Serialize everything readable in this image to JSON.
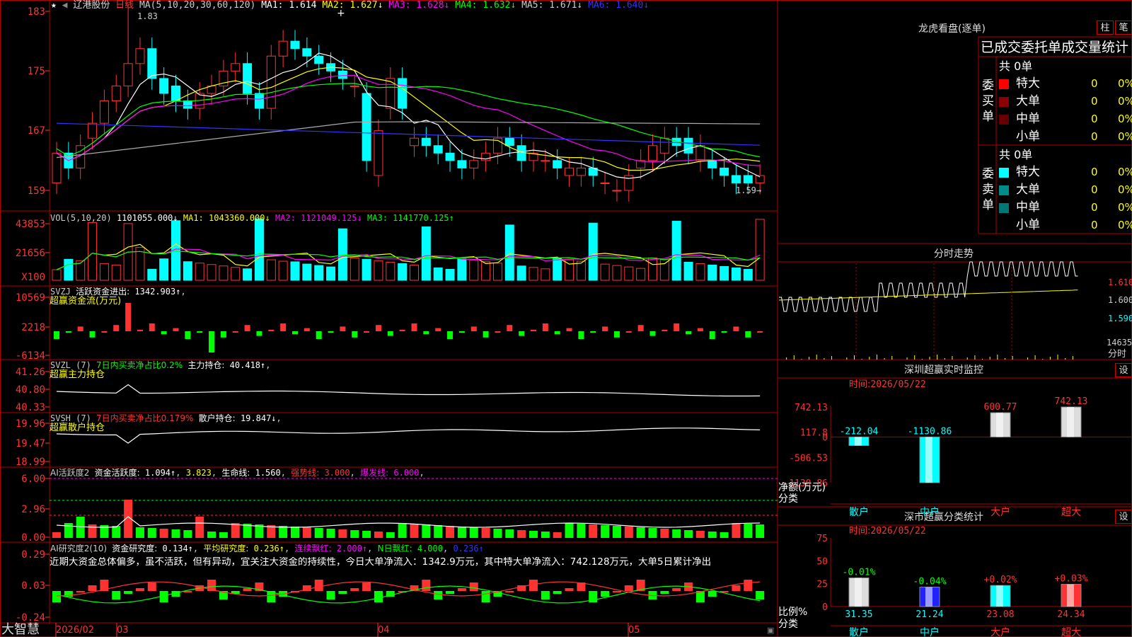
{
  "header": {
    "star": "★",
    "prev_arrow": "◀",
    "name": "辽港股份",
    "period": "日线",
    "ma_label": "MA(5,10,20,30,60,120)",
    "ma1_label": "MA1:",
    "ma1_value": "1.614",
    "ma2_label": "MA2:",
    "ma2_value": "1.627↓",
    "ma3_label": "MA3:",
    "ma3_value": "1.628↓",
    "ma4_label": "MA4:",
    "ma4_value": "1.632↓",
    "ma5_label": "MA5:",
    "ma5_value": "1.671↓",
    "ma6_label": "MA6:",
    "ma6_value": "1.640↓",
    "crosshair": "+"
  },
  "price_panel": {
    "axis": [
      "183",
      "175",
      "167",
      "159"
    ],
    "high_marker": "1.83",
    "low_marker": "1.59→"
  },
  "vol_panel": {
    "axis": [
      "43853",
      "21656"
    ],
    "unit": "X100",
    "label": "VOL(5,10,20)",
    "value": "1101055.000↓",
    "ma1_label": "MA1:",
    "ma1": "1043360.000↓",
    "ma2_label": "MA2:",
    "ma2": "1121049.125↓",
    "ma3_label": "MA3:",
    "ma3": "1141770.125↑"
  },
  "svzj_panel": {
    "axis": [
      "10569",
      "2218",
      "-6134"
    ],
    "label": "SVZJ",
    "desc": "活跃资金进出:",
    "value": "1342.903↑",
    "sub": "超赢资金流(万元)"
  },
  "svzl_panel": {
    "axis": [
      "41.26",
      "40.80",
      "40.33"
    ],
    "label": "SVZL  (7)",
    "ratio": "7日内买卖净占比0.2%",
    "desc": "主力持仓:",
    "value": "40.418↑",
    "sub": "超赢主力持仓"
  },
  "svsh_panel": {
    "axis": [
      "19.96",
      "19.47",
      "18.99"
    ],
    "label": "SVSH  (7)",
    "ratio": "7日内买卖净占比0.179%",
    "desc": "散户持仓:",
    "value": "19.847↓",
    "sub": "超赢散户持仓"
  },
  "ai_active_panel": {
    "axis": [
      "6.00",
      "2.96",
      "0.00"
    ],
    "label": "AI活跃度2",
    "desc": "资金活跃度:",
    "v1": "1.094↑",
    "v2": "3.823",
    "life_label": "生命线:",
    "life": "1.560",
    "strong_label": "强势线:",
    "strong": "3.000",
    "burst_label": "爆发线:",
    "burst": "6.000"
  },
  "ai_research_panel": {
    "axis": [
      "0.29",
      "0.03",
      "-0.24"
    ],
    "label": "AI研究度2(10)",
    "desc": "资金研究度:",
    "v1": "0.134↑",
    "avg_label": "平均研究度:",
    "avg": "0.236↑",
    "cont_label": "连续飘红:",
    "cont": "2.000↑",
    "n_label": "N日飘红:",
    "n": "4.000",
    "v2": "0.236↑",
    "commentary": "近期大资金总体偏多，虽不活跃，但有异动，宜关注大资金的持续性，今日大单净流入：1342.9万元，其中特大单净流入：742.128万元，大单5日累计净出"
  },
  "date_axis": {
    "brand": "大智慧",
    "labels": [
      "2026/02",
      "03",
      "04",
      "05"
    ]
  },
  "dragon_tiger": {
    "title": "龙虎看盘(逐单)",
    "btn_bar": "柱",
    "btn_tick": "笔",
    "tabs": [
      "已成交",
      "委托单",
      "成交量统计"
    ],
    "buy_title": "委买单",
    "sell_title": "委卖单",
    "buy_total": "共 0单",
    "sell_total": "共 0单",
    "buy_rows": [
      {
        "label": "特大",
        "count": "0",
        "pct": "0%",
        "color": "#ff0000"
      },
      {
        "label": "大单",
        "count": "0",
        "pct": "0%",
        "color": "#8b0000"
      },
      {
        "label": "中单",
        "count": "0",
        "pct": "0%",
        "color": "#660000"
      },
      {
        "label": "小单",
        "count": "0",
        "pct": "0%",
        "color": ""
      }
    ],
    "sell_rows": [
      {
        "label": "特大",
        "count": "0",
        "pct": "0%",
        "color": "#00ffff"
      },
      {
        "label": "大单",
        "count": "0",
        "pct": "0%",
        "color": "#008b8b"
      },
      {
        "label": "中单",
        "count": "0",
        "pct": "0%",
        "color": "#007777"
      },
      {
        "label": "小单",
        "count": "0",
        "pct": "0%",
        "color": ""
      }
    ]
  },
  "intraday": {
    "title": "分时走势",
    "axis": [
      "1.610",
      "1.600",
      "1.590"
    ],
    "vol": "14635",
    "unit": "分时"
  },
  "realtime_monitor": {
    "title": "深圳超赢实时监控",
    "settings": "设",
    "date_label": "时间:",
    "date": "2026/05/22",
    "axis": [
      "742.13",
      "117.8",
      "0",
      "-506.53",
      "-1130.86"
    ],
    "ylabel": "净额(万元)",
    "xlabel": "分类",
    "categories": [
      "散户",
      "中户",
      "大户",
      "超大"
    ],
    "values": [
      -212.04,
      -1130.86,
      600.77,
      742.13
    ],
    "value_labels": [
      "-212.04",
      "-1130.86",
      "600.77",
      "742.13"
    ]
  },
  "class_stats": {
    "title": "深市超赢分类统计",
    "settings": "设",
    "date_label": "时间:",
    "date": "2026/05/22",
    "axis": [
      "75",
      "50",
      "25",
      "0"
    ],
    "ylabel": "比例%",
    "xlabel": "分类",
    "categories": [
      "散户",
      "中户",
      "大户",
      "超大"
    ],
    "changes": [
      "-0.01%",
      "-0.04%",
      "+0.02%",
      "+0.03%"
    ],
    "values": [
      31.35,
      21.24,
      23.08,
      24.34
    ],
    "value_labels": [
      "31.35",
      "21.24",
      "23.08",
      "24.34"
    ]
  },
  "colors": {
    "up": "#ff3232",
    "down": "#00ffff",
    "grid": "#b00000",
    "ma1": "#ffffff",
    "ma2": "#ffff00",
    "ma3": "#ff00ff",
    "ma4": "#00ff00",
    "ma5": "#aaaaaa",
    "ma6": "#3333ff"
  }
}
